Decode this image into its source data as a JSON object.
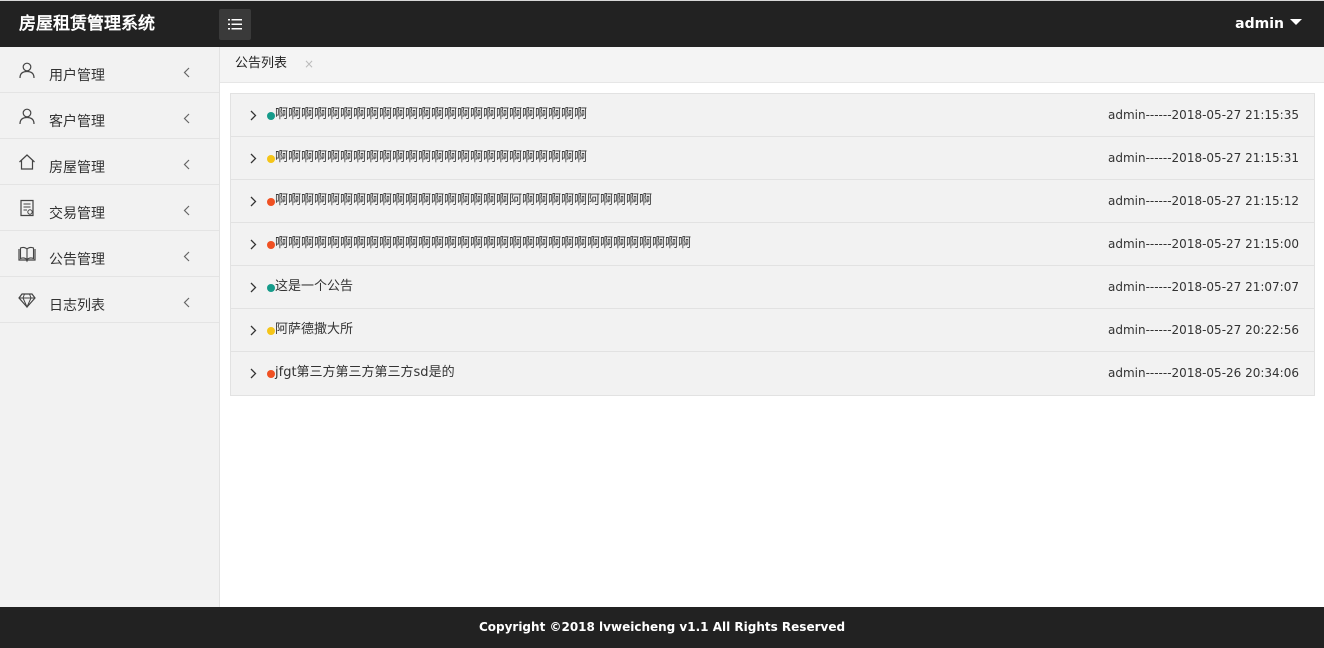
{
  "header": {
    "app_title": "房屋租赁管理系统",
    "menu_toggle_icon": "list-icon",
    "user_name": "admin",
    "user_caret_icon": "caret-down-icon"
  },
  "sidebar": {
    "items": [
      {
        "label": "用户管理",
        "icon": "user-icon"
      },
      {
        "label": "客户管理",
        "icon": "user-icon"
      },
      {
        "label": "房屋管理",
        "icon": "home-icon"
      },
      {
        "label": "交易管理",
        "icon": "receipt-icon"
      },
      {
        "label": "公告管理",
        "icon": "book-icon"
      },
      {
        "label": "日志列表",
        "icon": "diamond-icon"
      }
    ],
    "expand_icon": "chevron-left-icon"
  },
  "tabs": [
    {
      "label": "公告列表",
      "close_glyph": "×"
    }
  ],
  "notices": [
    {
      "title": "啊啊啊啊啊啊啊啊啊啊啊啊啊啊啊啊啊啊啊啊啊啊啊啊",
      "meta": "admin------2018-05-27 21:15:35",
      "dot_color": "#169b8a"
    },
    {
      "title": "啊啊啊啊啊啊啊啊啊啊啊啊啊啊啊啊啊啊啊啊啊啊啊啊",
      "meta": "admin------2018-05-27 21:15:31",
      "dot_color": "#f5c518"
    },
    {
      "title": "啊啊啊啊啊啊啊啊啊啊啊啊啊啊啊啊啊啊阿啊啊啊啊啊阿啊啊啊啊",
      "meta": "admin------2018-05-27 21:15:12",
      "dot_color": "#f05123"
    },
    {
      "title": "啊啊啊啊啊啊啊啊啊啊啊啊啊啊啊啊啊啊啊啊啊啊啊啊啊啊啊啊啊啊啊啊",
      "meta": "admin------2018-05-27 21:15:00",
      "dot_color": "#f05123"
    },
    {
      "title": "这是一个公告",
      "meta": "admin------2018-05-27 21:07:07",
      "dot_color": "#169b8a"
    },
    {
      "title": "阿萨德撒大所",
      "meta": "admin------2018-05-27 20:22:56",
      "dot_color": "#f5c518"
    },
    {
      "title": "jfgt第三方第三方第三方sd是的",
      "meta": "admin------2018-05-26 20:34:06",
      "dot_color": "#f05123"
    }
  ],
  "row_expand_icon": "chevron-right-icon",
  "footer": {
    "copyright": "Copyright ©2018 lvweicheng v1.1 All Rights Reserved"
  },
  "colors": {
    "header_bg": "#222222",
    "sidebar_bg": "#f2f2f2",
    "row_bg": "#f2f2f2",
    "dot_teal": "#169b8a",
    "dot_yellow": "#f5c518",
    "dot_orange": "#f05123"
  }
}
